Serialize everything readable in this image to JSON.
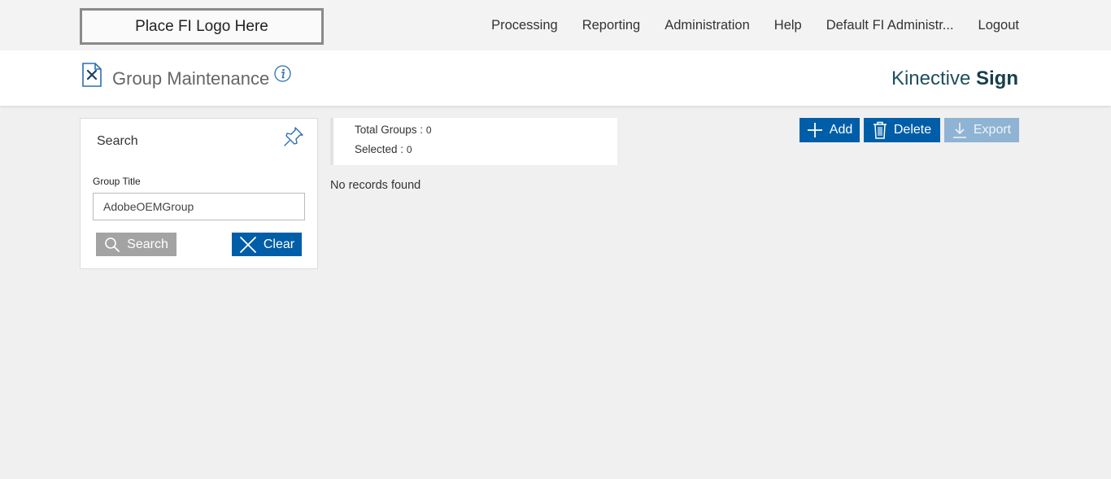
{
  "header": {
    "logo_text": "Place FI Logo Here",
    "nav": [
      "Processing",
      "Reporting",
      "Administration",
      "Help",
      "Default FI Administr...",
      "Logout"
    ]
  },
  "title_bar": {
    "page_title": "Group Maintenance",
    "brand_light": "Kinective",
    "brand_bold": "Sign"
  },
  "search": {
    "title": "Search",
    "group_title_label": "Group Title",
    "group_title_value": "AdobeOEMGroup",
    "search_label": "Search",
    "clear_label": "Clear"
  },
  "summary": {
    "total_label": "Total Groups :",
    "total_value": "0",
    "selected_label": "Selected :",
    "selected_value": "0",
    "empty_text": "No records found"
  },
  "actions": {
    "add_label": "Add",
    "delete_label": "Delete",
    "export_label": "Export"
  },
  "icons": {
    "doc": "document-tools-icon",
    "info": "info-icon",
    "pin": "pin-icon",
    "search": "magnifier-icon",
    "clear": "x-icon",
    "add": "plus-icon",
    "delete": "trash-icon",
    "export": "download-icon"
  },
  "colors": {
    "primary": "#005ea8",
    "disabled": "#8fb3d3",
    "neutral_button": "#a3a3a3",
    "brand_text": "#1f4f5a"
  }
}
